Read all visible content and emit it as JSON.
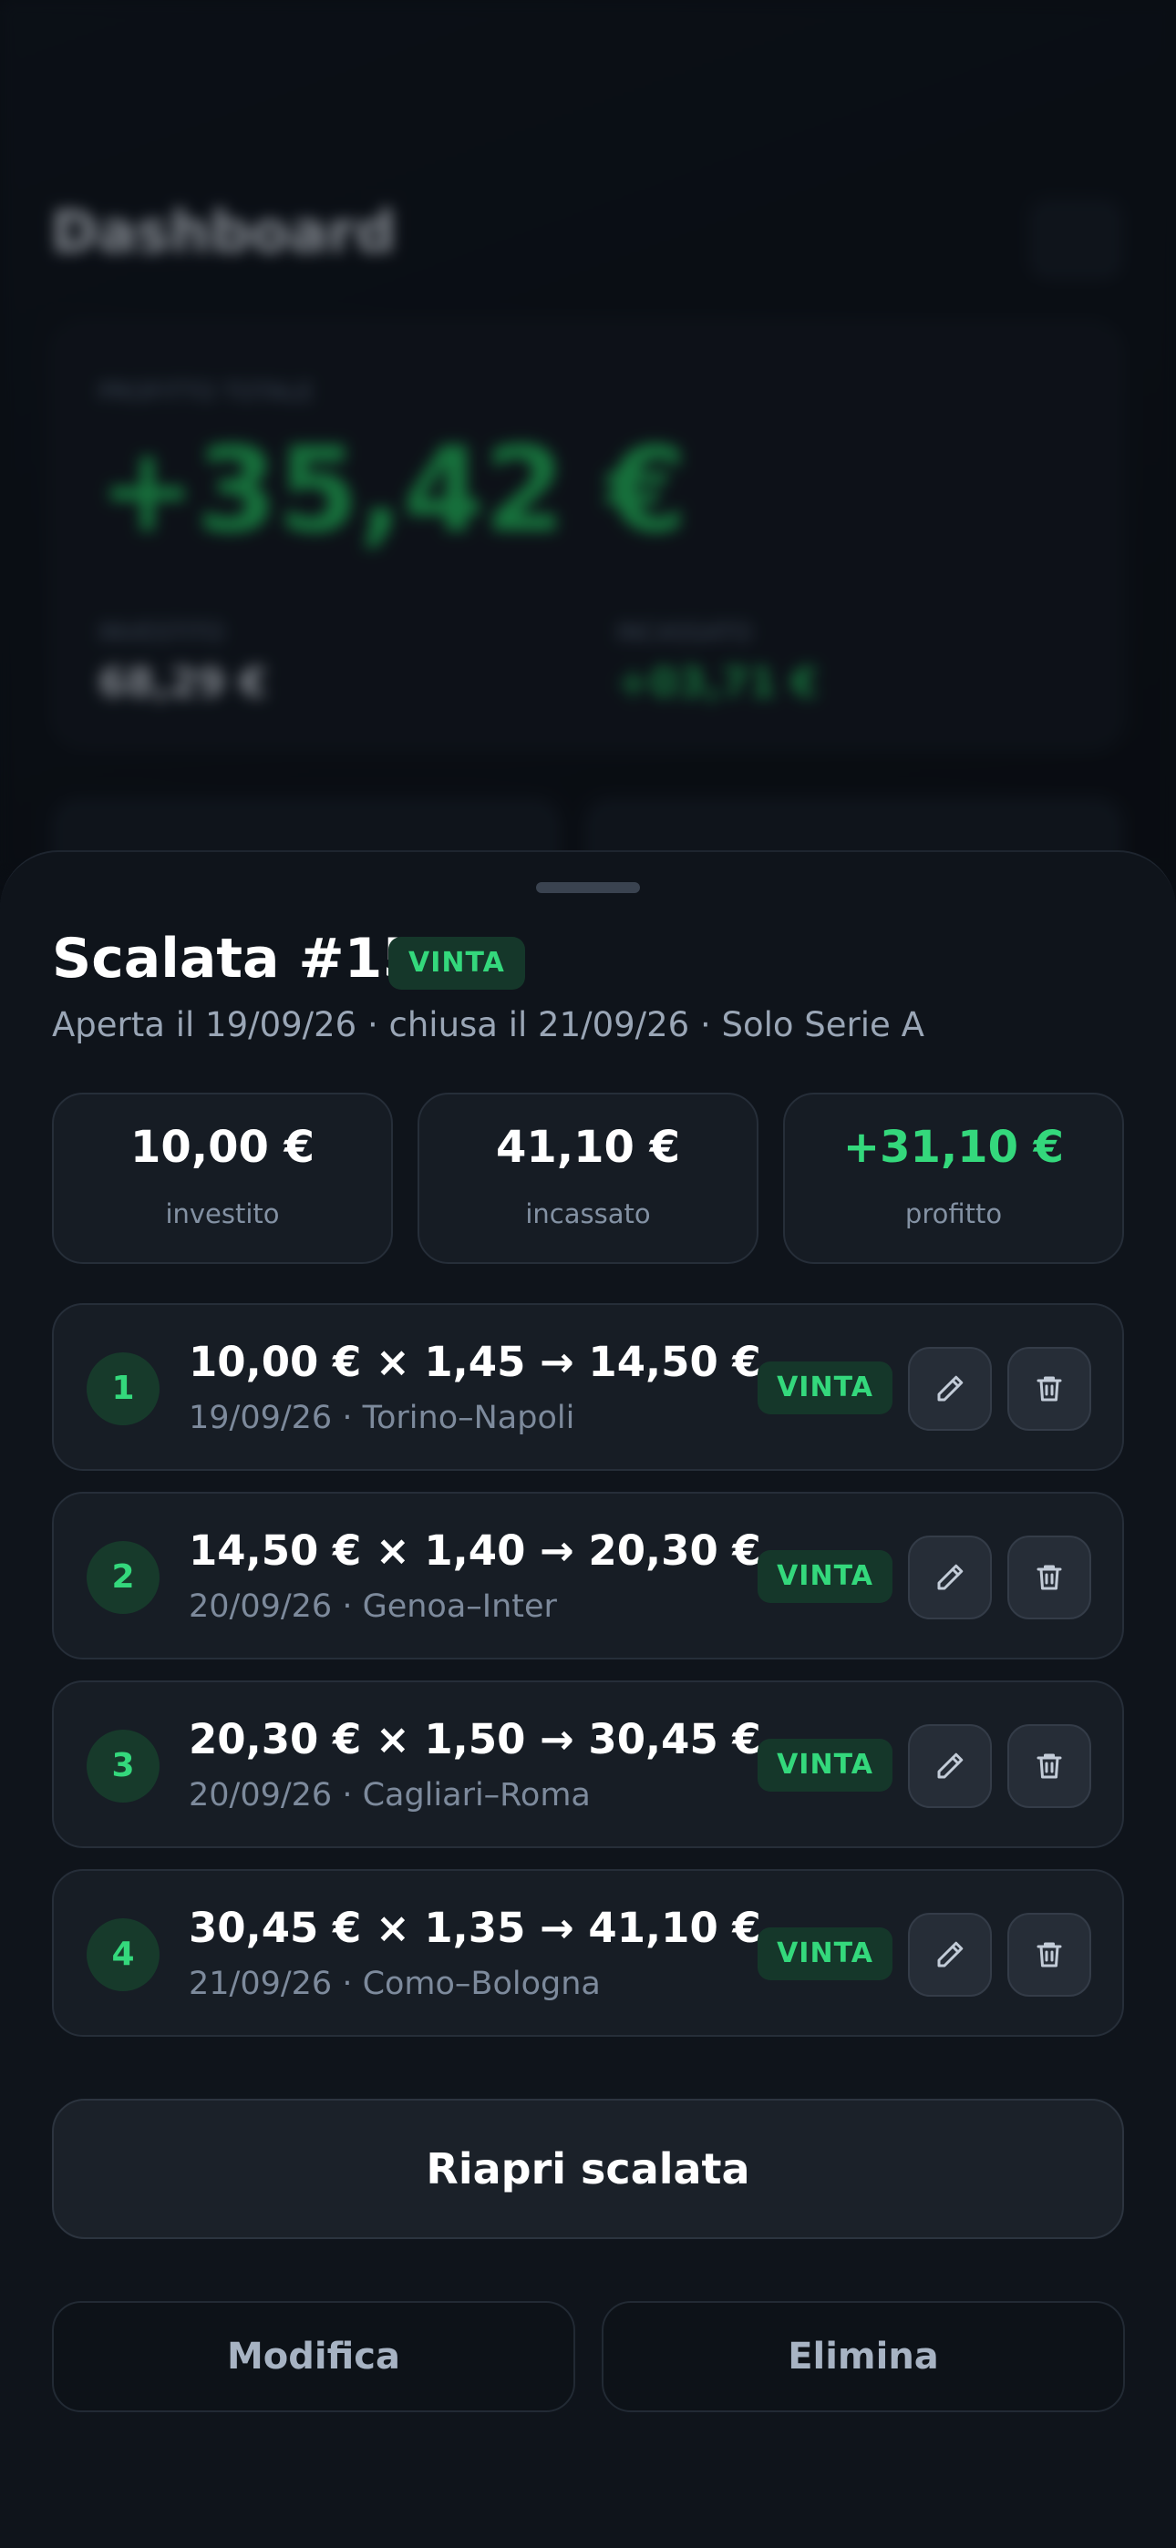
{
  "background": {
    "title": "Dashboard",
    "card_label": "PROFITTO TOTALE",
    "profit": "+35,42 €",
    "stat1_label": "INVESTITO",
    "stat1_value": "68,29 €",
    "stat2_label": "INCASSATO",
    "stat2_value": "+03,71 €"
  },
  "sheet": {
    "title": "Scalata #15",
    "status": "VINTA",
    "subtitle": "Aperta il 19/09/26 · chiusa il 21/09/26 · Solo Serie A",
    "stats": [
      {
        "value": "10,00 €",
        "label": "investito"
      },
      {
        "value": "41,10 €",
        "label": "incassato"
      },
      {
        "value": "+31,10 €",
        "label": "profitto"
      }
    ],
    "steps": [
      {
        "num": "1",
        "main": "10,00 € × 1,45 → 14,50 €",
        "sub": "19/09/26 · Torino–Napoli",
        "status": "VINTA"
      },
      {
        "num": "2",
        "main": "14,50 € × 1,40 → 20,30 €",
        "sub": "20/09/26 · Genoa–Inter",
        "status": "VINTA"
      },
      {
        "num": "3",
        "main": "20,30 € × 1,50 → 30,45 €",
        "sub": "20/09/26 · Cagliari–Roma",
        "status": "VINTA"
      },
      {
        "num": "4",
        "main": "30,45 € × 1,35 → 41,10 €",
        "sub": "21/09/26 · Como–Bologna",
        "status": "VINTA"
      }
    ],
    "reopen_label": "Riapri scalata",
    "edit_label": "Modifica",
    "delete_label": "Elimina"
  },
  "icons": {
    "edit": "pencil-icon",
    "delete": "trash-icon"
  },
  "colors": {
    "accent_green": "#34d87c",
    "badge_bg": "#15372a",
    "sheet_bg": "#0f141b"
  }
}
